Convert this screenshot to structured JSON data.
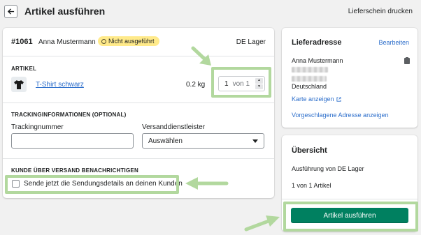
{
  "header": {
    "title": "Artikel ausführen",
    "print_label": "Lieferschein drucken"
  },
  "order": {
    "number": "#1061",
    "customer": "Anna Mustermann",
    "status": "Nicht ausgeführt",
    "location": "DE Lager"
  },
  "items": {
    "section_title": "ARTIKEL",
    "product_name": "T-Shirt schwarz",
    "weight": "0.2 kg",
    "quantity_value": "1",
    "quantity_total": "von 1"
  },
  "tracking": {
    "section_title": "TRACKINGINFORMATIONEN (OPTIONAL)",
    "number_label": "Trackingnummer",
    "number_value": "",
    "carrier_label": "Versanddienstleister",
    "carrier_selected": "Auswählen"
  },
  "notify": {
    "section_title": "KUNDE ÜBER VERSAND BENACHRICHTIGEN",
    "checkbox_label": "Sende jetzt die Sendungsdetails an deinen Kunden",
    "checked": false
  },
  "address": {
    "title": "Lieferadresse",
    "edit_label": "Bearbeiten",
    "name": "Anna Mustermann",
    "country": "Deutschland",
    "map_link": "Karte anzeigen",
    "suggest_link": "Vorgeschlagene Adresse anzeigen"
  },
  "summary": {
    "title": "Übersicht",
    "fulfillment_from": "Ausführung von DE Lager",
    "item_count": "1 von 1 Artikel",
    "submit_label": "Artikel ausführen"
  },
  "colors": {
    "primary": "#008060",
    "link": "#2c6ecb",
    "badge": "#ffea8a",
    "highlight": "#b2d89e"
  }
}
